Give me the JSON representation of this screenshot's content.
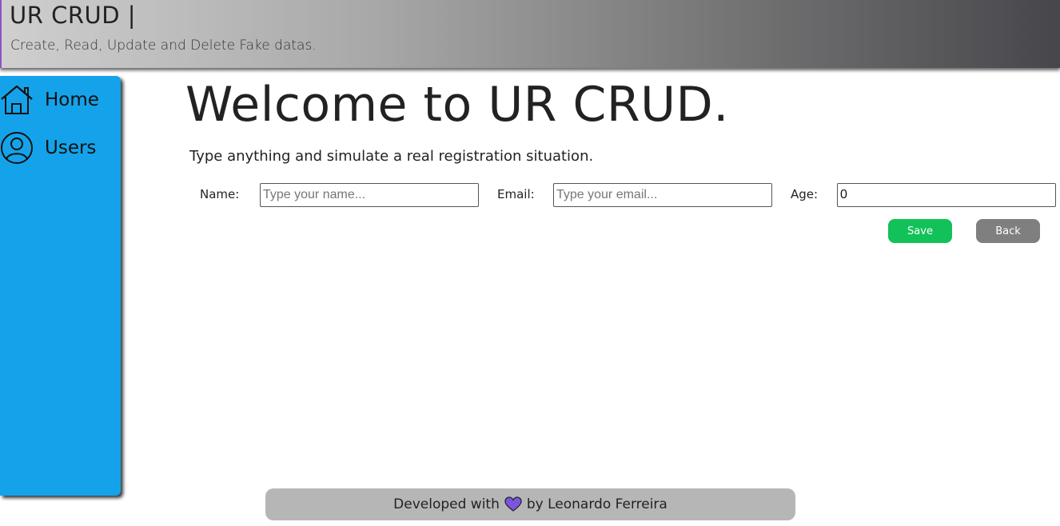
{
  "header": {
    "title": "UR CRUD |",
    "subtitle": "Create, Read, Update and Delete Fake datas."
  },
  "sidebar": {
    "items": [
      {
        "label": "Home",
        "icon": "home-icon"
      },
      {
        "label": "Users",
        "icon": "user-circle-icon"
      }
    ],
    "color": "#14a3ea"
  },
  "main": {
    "title": "Welcome to UR CRUD.",
    "intro": "Type anything and simulate a real registration situation."
  },
  "form": {
    "name": {
      "label": "Name:",
      "placeholder": "Type your name...",
      "value": ""
    },
    "email": {
      "label": "Email:",
      "placeholder": "Type your email...",
      "value": ""
    },
    "age": {
      "label": "Age:",
      "value": "0"
    },
    "save_label": "Save",
    "back_label": "Back",
    "save_color": "#12c259",
    "back_color": "#7f7f7f"
  },
  "footer": {
    "prefix": "Developed with",
    "suffix": "by Leonardo Ferreira",
    "heart_icon": "heart-icon",
    "heart_color": "#7b55e0"
  }
}
